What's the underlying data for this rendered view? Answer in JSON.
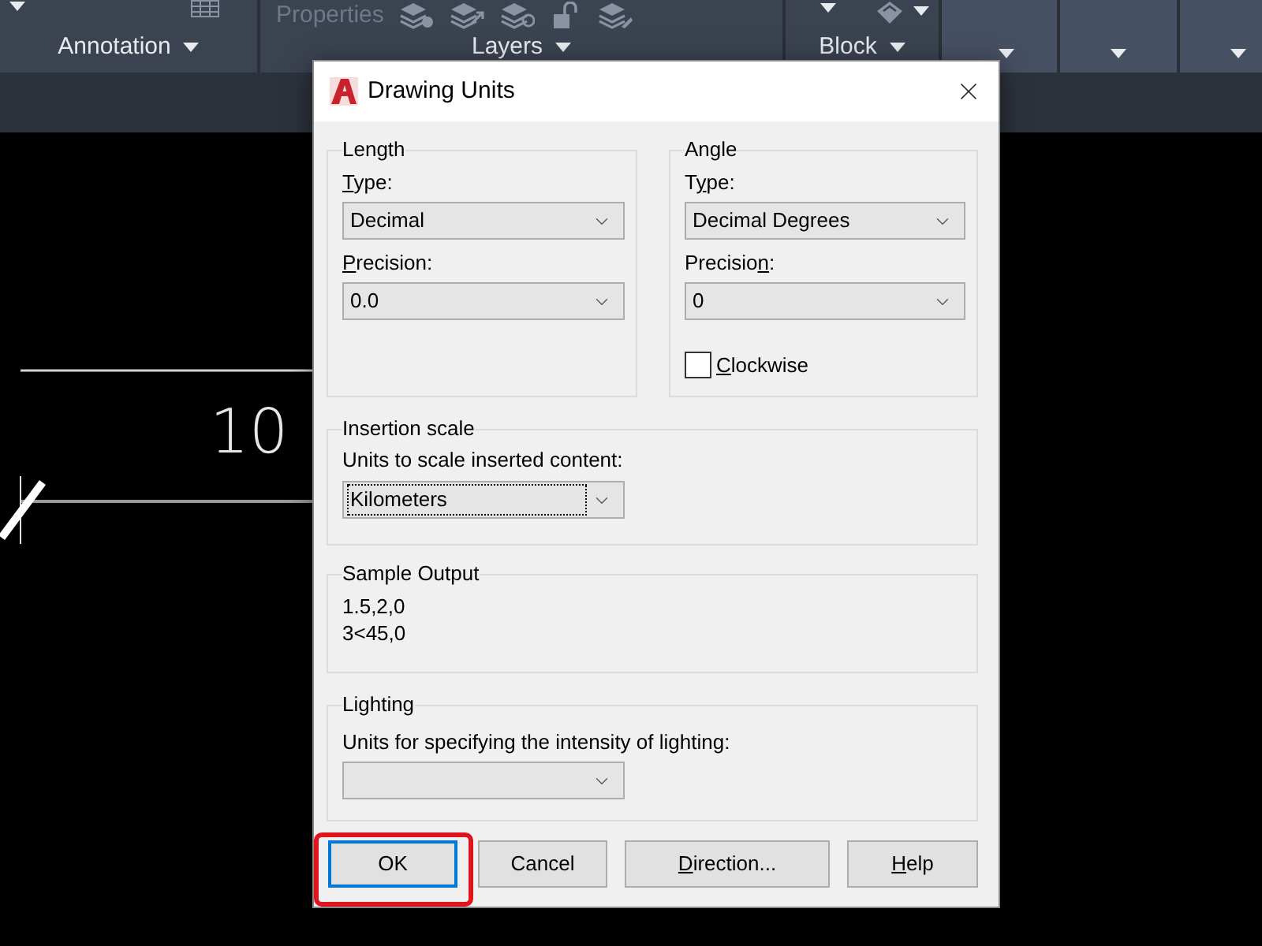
{
  "ribbon": {
    "annotation_panel": {
      "title": "Annotation"
    },
    "layers_panel": {
      "properties": {
        "label": "Properties",
        "disabled": true
      },
      "title": "Layers"
    },
    "block_panel": {
      "title": "Block"
    }
  },
  "drawing": {
    "dimension_text": "10"
  },
  "dialog": {
    "title": "Drawing Units",
    "length": {
      "title": "Length",
      "type_label": [
        {
          "text": "T",
          "underlined": true
        },
        {
          "text": "ype:",
          "underlined": false
        }
      ],
      "type_select": {
        "value": "Decimal",
        "focused": false
      },
      "precision_label": [
        {
          "text": "P",
          "underlined": true
        },
        {
          "text": "recision:",
          "underlined": false
        }
      ],
      "precision_select": {
        "value": "0.0",
        "focused": false
      }
    },
    "angle": {
      "title": "Angle",
      "type_label": [
        {
          "text": "T",
          "underlined": false
        },
        {
          "text": "y",
          "underlined": true
        },
        {
          "text": "pe:",
          "underlined": false
        }
      ],
      "type_select": {
        "value": "Decimal Degrees",
        "focused": false
      },
      "precision_label": [
        {
          "text": "Precisio",
          "underlined": false
        },
        {
          "text": "n",
          "underlined": true
        },
        {
          "text": ":",
          "underlined": false
        }
      ],
      "precision_select": {
        "value": "0",
        "focused": false
      },
      "clockwise": {
        "label": [
          {
            "text": "C",
            "underlined": true
          },
          {
            "text": "lockwise",
            "underlined": false
          }
        ],
        "checked": false
      }
    },
    "insertion_scale": {
      "title": "Insertion scale",
      "label": "Units to scale inserted content:",
      "select": {
        "value": "Kilometers",
        "focused": true
      }
    },
    "sample_output": {
      "title": "Sample Output",
      "lines": [
        "1.5,2,0",
        "3<45,0"
      ]
    },
    "lighting": {
      "title": "Lighting",
      "label": "Units for specifying the intensity of lighting:",
      "select": {
        "focused": false
      }
    },
    "buttons": [
      {
        "label": [
          {
            "text": "OK",
            "underlined": false
          }
        ],
        "default": true,
        "highlighted": true
      },
      {
        "label": [
          {
            "text": "Cancel",
            "underlined": false
          }
        ],
        "default": false,
        "highlighted": false
      },
      {
        "label": [
          {
            "text": "D",
            "underlined": true
          },
          {
            "text": "irection...",
            "underlined": false
          }
        ],
        "default": false,
        "highlighted": false
      },
      {
        "label": [
          {
            "text": "H",
            "underlined": true
          },
          {
            "text": "elp",
            "underlined": false
          }
        ],
        "default": false,
        "highlighted": false
      }
    ]
  }
}
